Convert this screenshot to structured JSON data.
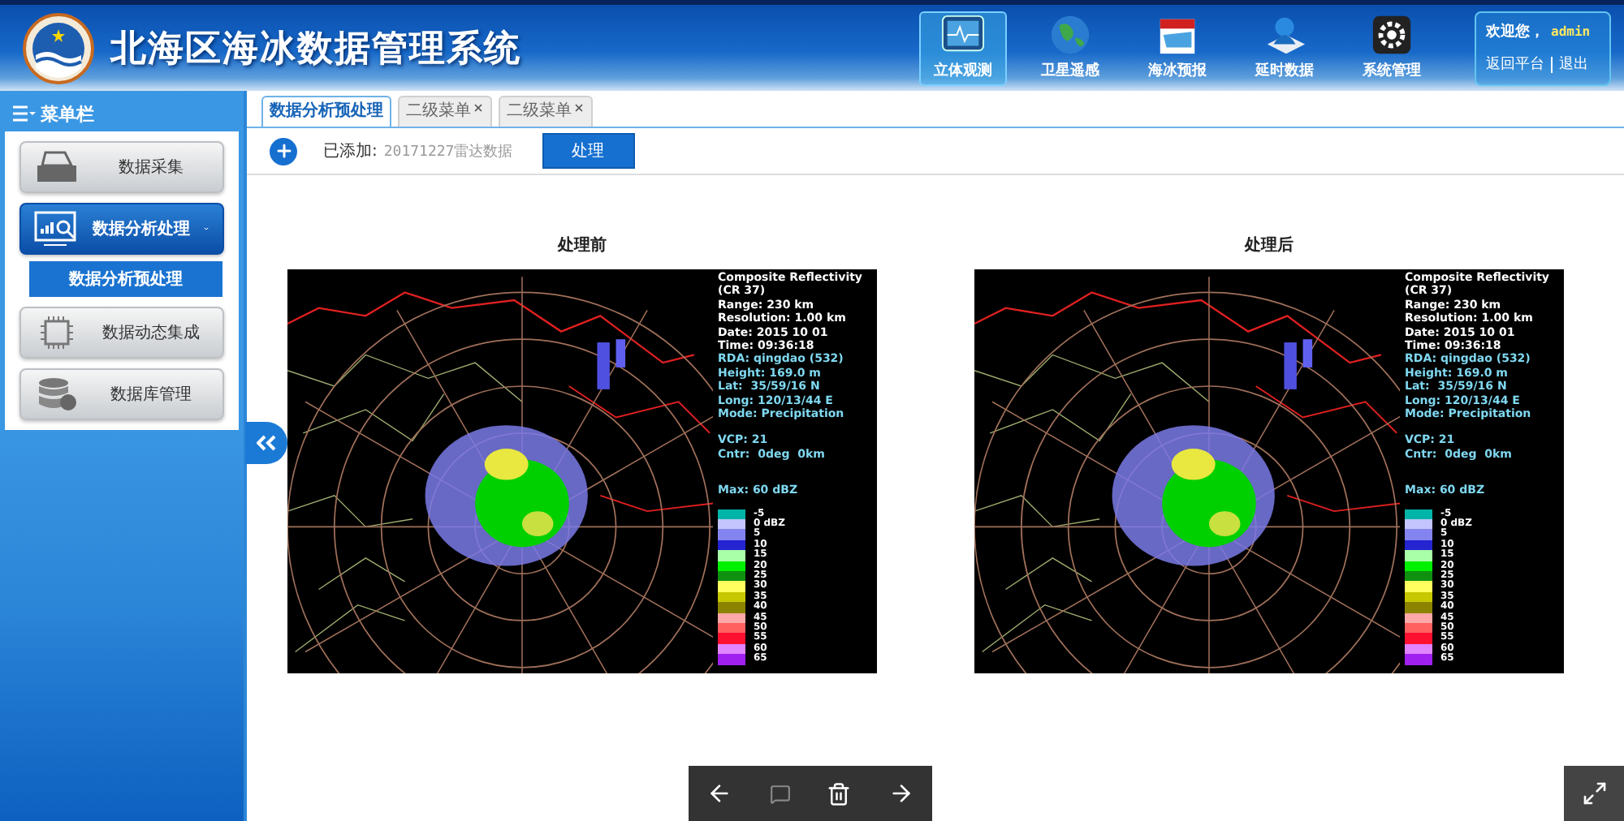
{
  "header": {
    "title": "北海区海冰数据管理系统",
    "nav": [
      {
        "label": "立体观测",
        "kind": "monitor",
        "selected": true
      },
      {
        "label": "卫星遥感",
        "kind": "globe",
        "selected": false
      },
      {
        "label": "海冰预报",
        "kind": "calendar",
        "selected": false
      },
      {
        "label": "延时数据",
        "kind": "user",
        "selected": false
      },
      {
        "label": "系统管理",
        "kind": "gear",
        "selected": false
      }
    ],
    "user": {
      "greeting": "欢迎您，",
      "name": "admin",
      "links": [
        "返回平台",
        "退出"
      ]
    }
  },
  "sidebar": {
    "title": "菜单栏",
    "items": [
      {
        "label": "数据采集",
        "kind": "folder",
        "selected": false,
        "expanded": false
      },
      {
        "label": "数据分析处理",
        "kind": "chart",
        "selected": true,
        "expanded": true,
        "children": [
          {
            "label": "数据分析预处理",
            "selected": true
          }
        ]
      },
      {
        "label": "数据动态集成",
        "kind": "chip",
        "selected": false,
        "expanded": false
      },
      {
        "label": "数据库管理",
        "kind": "database",
        "selected": false,
        "expanded": false
      }
    ]
  },
  "tabs": [
    {
      "label": "数据分析预处理",
      "selected": true,
      "closable": false
    },
    {
      "label": "二级菜单",
      "selected": false,
      "closable": true
    },
    {
      "label": "二级菜单",
      "selected": false,
      "closable": true
    }
  ],
  "toolbar": {
    "added_label": "已添加:",
    "added_value": "20171227雷达数据",
    "button": "处理"
  },
  "panels": [
    {
      "title": "处理前",
      "header_lines": [
        "Composite Reflectivity",
        "(CR 37)",
        "Range: 230 km",
        "Resolution: 1.00 km",
        "Date: 2015 10 01",
        "Time: 09:36:18"
      ],
      "site_lines": [
        "RDA: qingdao (532)",
        "Height: 169.0 m",
        "Lat:  35/59/16 N",
        "Long: 120/13/44 E",
        "Mode: Precipitation"
      ],
      "scan_lines": [
        "VCP: 21",
        "Cntr:  0deg  0km"
      ],
      "max": "Max: 60 dBZ",
      "legend": [
        {
          "label": "-5",
          "color": "#00b4a8"
        },
        {
          "label": "0 dBZ",
          "color": "#c4c4ff"
        },
        {
          "label": "5",
          "color": "#8484f0"
        },
        {
          "label": "10",
          "color": "#2424d0"
        },
        {
          "label": "15",
          "color": "#a8ffa8"
        },
        {
          "label": "20",
          "color": "#00f000"
        },
        {
          "label": "25",
          "color": "#109010"
        },
        {
          "label": "30",
          "color": "#ffff60"
        },
        {
          "label": "35",
          "color": "#c8c800"
        },
        {
          "label": "40",
          "color": "#8c8400"
        },
        {
          "label": "45",
          "color": "#ffa8a8"
        },
        {
          "label": "50",
          "color": "#ff6060"
        },
        {
          "label": "55",
          "color": "#ff1030"
        },
        {
          "label": "60",
          "color": "#e084ff"
        },
        {
          "label": "65",
          "color": "#a020f0"
        }
      ]
    },
    {
      "title": "处理后",
      "header_lines": [
        "Composite Reflectivity",
        "(CR 37)",
        "Range: 230 km",
        "Resolution: 1.00 km",
        "Date: 2015 10 01",
        "Time: 09:36:18"
      ],
      "site_lines": [
        "RDA: qingdao (532)",
        "Height: 169.0 m",
        "Lat:  35/59/16 N",
        "Long: 120/13/44 E",
        "Mode: Precipitation"
      ],
      "scan_lines": [
        "VCP: 21",
        "Cntr:  0deg  0km"
      ],
      "max": "Max: 60 dBZ",
      "legend": [
        {
          "label": "-5",
          "color": "#00b4a8"
        },
        {
          "label": "0 dBZ",
          "color": "#c4c4ff"
        },
        {
          "label": "5",
          "color": "#8484f0"
        },
        {
          "label": "10",
          "color": "#2424d0"
        },
        {
          "label": "15",
          "color": "#a8ffa8"
        },
        {
          "label": "20",
          "color": "#00f000"
        },
        {
          "label": "25",
          "color": "#109010"
        },
        {
          "label": "30",
          "color": "#ffff60"
        },
        {
          "label": "35",
          "color": "#c8c800"
        },
        {
          "label": "40",
          "color": "#8c8400"
        },
        {
          "label": "45",
          "color": "#ffa8a8"
        },
        {
          "label": "50",
          "color": "#ff6060"
        },
        {
          "label": "55",
          "color": "#ff1030"
        },
        {
          "label": "60",
          "color": "#e084ff"
        },
        {
          "label": "65",
          "color": "#a020f0"
        }
      ]
    }
  ]
}
